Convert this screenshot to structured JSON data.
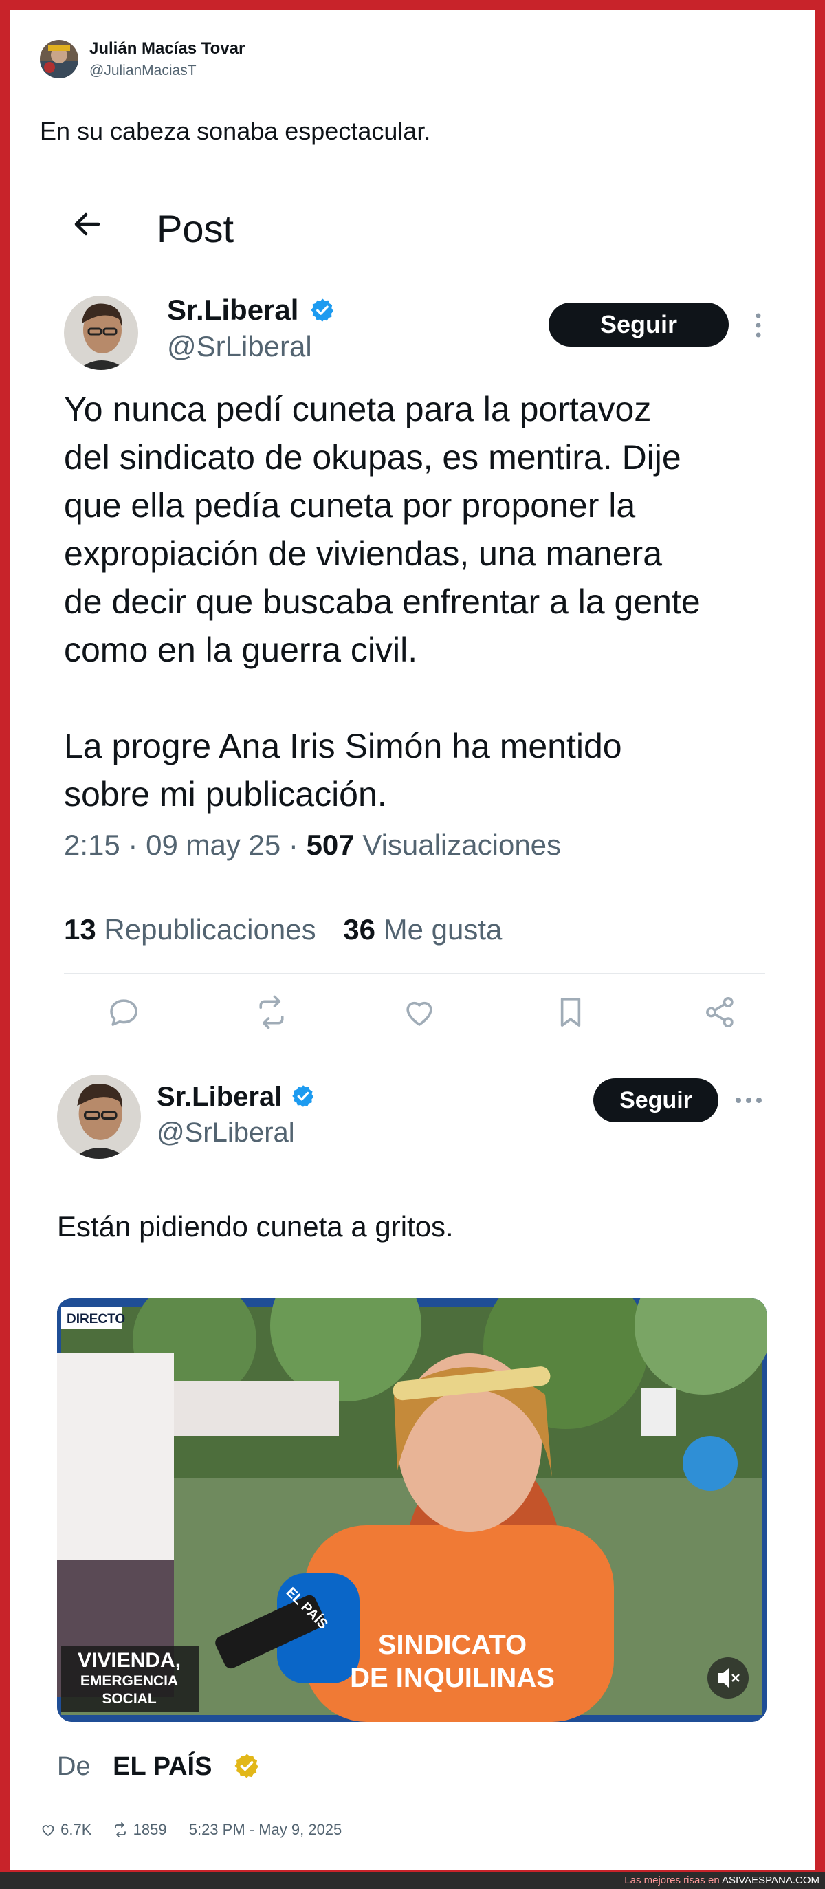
{
  "outer_post": {
    "author_name": "Julián Macías Tovar",
    "author_handle": "@JulianMaciasT",
    "text": "En su cabeza sonaba espectacular.",
    "likes": "6.7K",
    "retweets": "1859",
    "timestamp": "5:23 PM - May 9, 2025"
  },
  "quoted_screenshot": {
    "header_title": "Post",
    "author_name": "Sr.Liberal",
    "author_handle": "@SrLiberal",
    "follow_label": "Seguir",
    "paragraphs": [
      "Yo nunca pedí cuneta para la portavoz",
      "del sindicato de okupas, es mentira. Dije",
      "que ella pedía cuneta por proponer la",
      "expropiación de viviendas, una manera",
      "de decir que buscaba enfrentar a la gente",
      "como en la guerra civil.",
      "La progre Ana Iris Simón ha mentido",
      "sobre mi publicación."
    ],
    "meta": {
      "time": "2:15",
      "dot": "·",
      "date": "09 may 25",
      "views_count": "507",
      "views_label": "Visualizaciones"
    },
    "stats": {
      "reposts_count": "13",
      "reposts_label": "Republicaciones",
      "likes_count": "36",
      "likes_label": "Me gusta"
    }
  },
  "quoted_post": {
    "author_name": "Sr.Liberal",
    "author_handle": "@SrLiberal",
    "follow_label": "Seguir",
    "text": "Están pidiendo cuneta a gritos.",
    "video": {
      "live_badge": "DIRECTO",
      "banner_line1": "VIVIENDA,",
      "banner_line2": "EMERGENCIA",
      "banner_line3": "SOCIAL",
      "shirt_line1": "SINDICATO",
      "shirt_line2": "DE INQUILINAS",
      "mic_label": "EL PAÍS"
    },
    "source_prefix": "De",
    "source_name": "EL PAÍS"
  },
  "footer": {
    "prefix": "Las mejores risas en",
    "site": "ASIVAESPANA.COM"
  },
  "colors": {
    "frame": "#c8232a",
    "verified_blue": "#1d9bf0",
    "verified_gold": "#e2b719",
    "text_dark": "#0f1419",
    "text_muted": "#536471"
  }
}
